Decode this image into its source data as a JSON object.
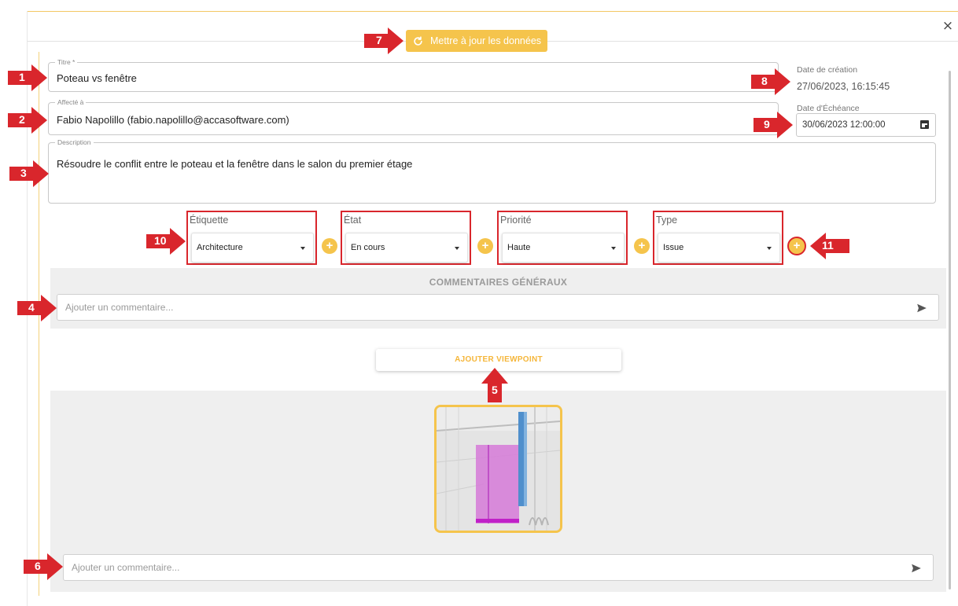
{
  "header": {
    "update_button_label": "Mettre à jour les données",
    "close_symbol": "×"
  },
  "form": {
    "title": {
      "legend": "Titre *",
      "value": "Poteau vs fenêtre"
    },
    "assigned": {
      "legend": "Affecté à",
      "value": "Fabio Napolillo  (fabio.napolillo@accasoftware.com)"
    },
    "description": {
      "legend": "Description",
      "value": "Résoudre le conflit entre le poteau et la fenêtre dans le salon du premier étage"
    },
    "creation_date": {
      "label": "Date de création",
      "value": "27/06/2023, 16:15:45"
    },
    "due_date": {
      "label": "Date d'Échéance",
      "value": "30/06/2023 12:00:00"
    }
  },
  "selects": [
    {
      "label": "Étiquette",
      "value": "Architecture"
    },
    {
      "label": "État",
      "value": "En cours"
    },
    {
      "label": "Priorité",
      "value": "Haute"
    },
    {
      "label": "Type",
      "value": "Issue"
    }
  ],
  "plus_symbol": "+",
  "general_comments": {
    "title": "COMMENTAIRES GÉNÉRAUX",
    "placeholder": "Ajouter un commentaire..."
  },
  "viewpoint": {
    "add_button_label": "AJOUTER VIEWPOINT",
    "comment_placeholder": "Ajouter un commentaire..."
  },
  "callouts": [
    "1",
    "2",
    "3",
    "4",
    "5",
    "6",
    "7",
    "8",
    "9",
    "10",
    "11"
  ],
  "colors": {
    "accent": "#f5c44c",
    "annotation_red": "#d9262c",
    "selection_magenta": "#d050d8"
  },
  "icons": {
    "close": "close-icon",
    "refresh": "refresh-icon",
    "calendar": "calendar-icon",
    "send": "send-icon",
    "caret": "caret-down-icon",
    "add": "plus-icon"
  }
}
